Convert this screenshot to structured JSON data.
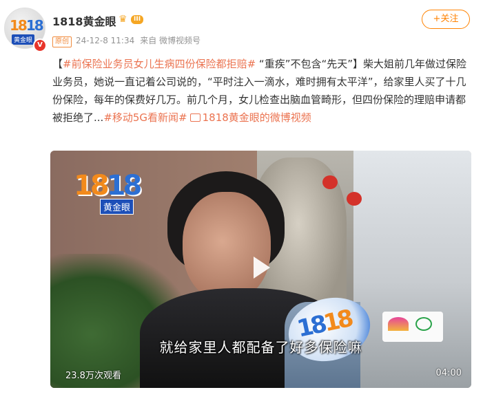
{
  "author": {
    "name": "1818黄金眼",
    "level": "III",
    "avatar_text": "18 18",
    "avatar_sub": "黄金眼"
  },
  "meta": {
    "badge": "原创",
    "time": "24-12-8 11:34",
    "source": "来自 微博视频号"
  },
  "follow_label": "+关注",
  "post": {
    "open_bracket": "【",
    "topic": "#前保险业务员女儿生病四份保险都拒赔#",
    "body1": " “重疾”不包含“先天”】柴大姐前几年做过保险业务员，她说一直记着公司说的，“平时注入一滴水，难时拥有太平洋”，给家里人买了十几份保险，每年的保费好几万。前几个月，女儿检查出脑血管畸形，但四份保险的理赔申请都被拒绝了...",
    "tag2": "#移动5G看新闻#",
    "link": "1818黄金眼的微博视频"
  },
  "video": {
    "logo_sub": "黄金眼",
    "subtitle": "就给家里人都配备了好多保险嘛",
    "views": "23.8万次观看",
    "duration": "04:00"
  }
}
